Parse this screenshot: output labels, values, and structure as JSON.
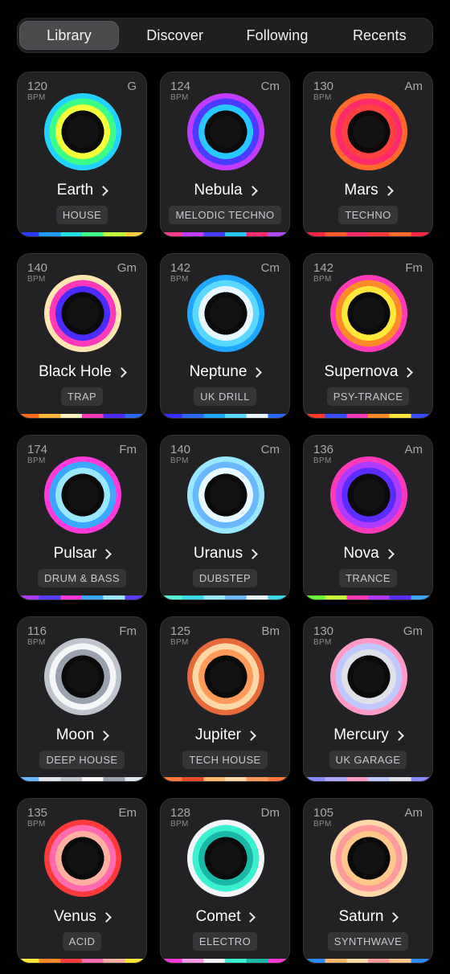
{
  "tabs": [
    {
      "label": "Library",
      "active": true
    },
    {
      "label": "Discover",
      "active": false
    },
    {
      "label": "Following",
      "active": false
    },
    {
      "label": "Recents",
      "active": false
    }
  ],
  "bpm_unit": "BPM",
  "cards": [
    {
      "bpm": "120",
      "key": "G",
      "name": "Earth",
      "genre": "HOUSE",
      "rings": [
        "#3a2cff",
        "#1f7bff",
        "#22d3ff",
        "#3dff88",
        "#f5ff3a",
        "#0a0a0a"
      ],
      "stripe": [
        "#2a3cff",
        "#1f9bff",
        "#22e0e0",
        "#3dff88",
        "#c0ff3a",
        "#ffd23a"
      ]
    },
    {
      "bpm": "124",
      "key": "Cm",
      "name": "Nebula",
      "genre": "MELODIC TECHNO",
      "rings": [
        "#ff2d6f",
        "#ff3aa8",
        "#c23cff",
        "#4a3cff",
        "#25c9ff",
        "#0a0a0a"
      ],
      "stripe": [
        "#ff3a8a",
        "#c23cff",
        "#4a3cff",
        "#25c9ff",
        "#ff2d6f",
        "#b04aff"
      ]
    },
    {
      "bpm": "130",
      "key": "Am",
      "name": "Mars",
      "genre": "TECHNO",
      "rings": [
        "#ff2545",
        "#ff3a3a",
        "#ff6a2a",
        "#ff2a6a",
        "#ff4040",
        "#0a0a0a"
      ],
      "stripe": [
        "#ff2545",
        "#ff5a2a",
        "#ff2a6a",
        "#ff3a3a",
        "#ff6a2a",
        "#ff2545"
      ]
    },
    {
      "bpm": "140",
      "key": "Gm",
      "name": "Black Hole",
      "genre": "TRAP",
      "rings": [
        "#ff6a1a",
        "#ffb83a",
        "#ffe6b0",
        "#ff3ab8",
        "#4a2cff",
        "#0a0a0a"
      ],
      "stripe": [
        "#ff6a1a",
        "#ffb83a",
        "#fff3c0",
        "#ff3ab8",
        "#4a2cff",
        "#2a6aff"
      ]
    },
    {
      "bpm": "142",
      "key": "Cm",
      "name": "Neptune",
      "genre": "UK DRILL",
      "rings": [
        "#3a2cff",
        "#2a6aff",
        "#1fa8ff",
        "#5ad8ff",
        "#e8f6ff",
        "#0a0a0a"
      ],
      "stripe": [
        "#3a2cff",
        "#2a6aff",
        "#1fa8ff",
        "#5ad8ff",
        "#e8f6ff",
        "#2a6aff"
      ]
    },
    {
      "bpm": "142",
      "key": "Fm",
      "name": "Supernova",
      "genre": "PSY-TRANCE",
      "rings": [
        "#ff3a2a",
        "#3a4cff",
        "#ff3ab8",
        "#ff8a2a",
        "#ffe83a",
        "#0a0a0a"
      ],
      "stripe": [
        "#ff3a2a",
        "#3a4cff",
        "#ff3ab8",
        "#ff8a2a",
        "#ffe83a",
        "#3a4cff"
      ]
    },
    {
      "bpm": "174",
      "key": "Fm",
      "name": "Pulsar",
      "genre": "DRUM & BASS",
      "rings": [
        "#b03aff",
        "#5a3cff",
        "#ff3ad8",
        "#3aa8ff",
        "#9ae8ff",
        "#0a0a0a"
      ],
      "stripe": [
        "#b03aff",
        "#5a3cff",
        "#ff3ad8",
        "#3aa8ff",
        "#9ae8ff",
        "#5a3cff"
      ]
    },
    {
      "bpm": "140",
      "key": "Cm",
      "name": "Uranus",
      "genre": "DUBSTEP",
      "rings": [
        "#5af0d8",
        "#3ad8e8",
        "#9ae8ff",
        "#6ab8ff",
        "#e8faff",
        "#0a0a0a"
      ],
      "stripe": [
        "#5af0d8",
        "#3ad8e8",
        "#9ae8ff",
        "#6ab8ff",
        "#e8faff",
        "#3ad8e8"
      ]
    },
    {
      "bpm": "136",
      "key": "Am",
      "name": "Nova",
      "genre": "TRANCE",
      "rings": [
        "#6aff3a",
        "#c8ff3a",
        "#ff3ab8",
        "#b03aff",
        "#5a2cff",
        "#0a0a0a"
      ],
      "stripe": [
        "#6aff3a",
        "#c8ff3a",
        "#ff3ab8",
        "#b03aff",
        "#5a2cff",
        "#3aa8ff"
      ]
    },
    {
      "bpm": "116",
      "key": "Fm",
      "name": "Moon",
      "genre": "DEEP HOUSE",
      "rings": [
        "#6ab8ff",
        "#e0e6ee",
        "#c0c4cc",
        "#f4f6f8",
        "#9aa2ae",
        "#0a0a0a"
      ],
      "stripe": [
        "#6ab8ff",
        "#e0e6ee",
        "#c0c4cc",
        "#f4f6f8",
        "#9aa2ae",
        "#e0e6ee"
      ]
    },
    {
      "bpm": "125",
      "key": "Bm",
      "name": "Jupiter",
      "genre": "TECH HOUSE",
      "rings": [
        "#ff7a3a",
        "#ffb86a",
        "#e86a3a",
        "#ffd8a8",
        "#ff9a5a",
        "#0a0a0a"
      ],
      "stripe": [
        "#ff7a3a",
        "#e84a2a",
        "#ffb86a",
        "#ffd8a8",
        "#ff9a5a",
        "#ff7a3a"
      ]
    },
    {
      "bpm": "130",
      "key": "Gm",
      "name": "Mercury",
      "genre": "UK GARAGE",
      "rings": [
        "#8a8aff",
        "#b0a8ff",
        "#ff9ac8",
        "#c0c8ff",
        "#e0e0e8",
        "#0a0a0a"
      ],
      "stripe": [
        "#8a8aff",
        "#b0a8ff",
        "#ff9ac8",
        "#c0c8ff",
        "#e0e0e8",
        "#8a8aff"
      ]
    },
    {
      "bpm": "135",
      "key": "Em",
      "name": "Venus",
      "genre": "ACID",
      "rings": [
        "#ffe83a",
        "#ff8a2a",
        "#ff3a3a",
        "#ff6ab0",
        "#ffb0a0",
        "#0a0a0a"
      ],
      "stripe": [
        "#ffe83a",
        "#ff8a2a",
        "#ff3a3a",
        "#ff6ab0",
        "#ffb0a0",
        "#ffe83a"
      ]
    },
    {
      "bpm": "128",
      "key": "Dm",
      "name": "Comet",
      "genre": "ELECTRO",
      "rings": [
        "#ff3ad8",
        "#ff9ae8",
        "#f4f4f8",
        "#3af0d0",
        "#1ab8a8",
        "#0a0a0a"
      ],
      "stripe": [
        "#ff3ad8",
        "#ff9ae8",
        "#f4f4f8",
        "#3af0d0",
        "#1ab8a8",
        "#ff3ad8"
      ]
    },
    {
      "bpm": "105",
      "key": "Am",
      "name": "Saturn",
      "genre": "SYNTHWAVE",
      "rings": [
        "#2a8aff",
        "#ffb86a",
        "#ffd8a8",
        "#ff9a9a",
        "#ffc88a",
        "#0a0a0a"
      ],
      "stripe": [
        "#2a8aff",
        "#ffb86a",
        "#ffd8a8",
        "#ff9a9a",
        "#ffc88a",
        "#2a8aff"
      ]
    }
  ]
}
